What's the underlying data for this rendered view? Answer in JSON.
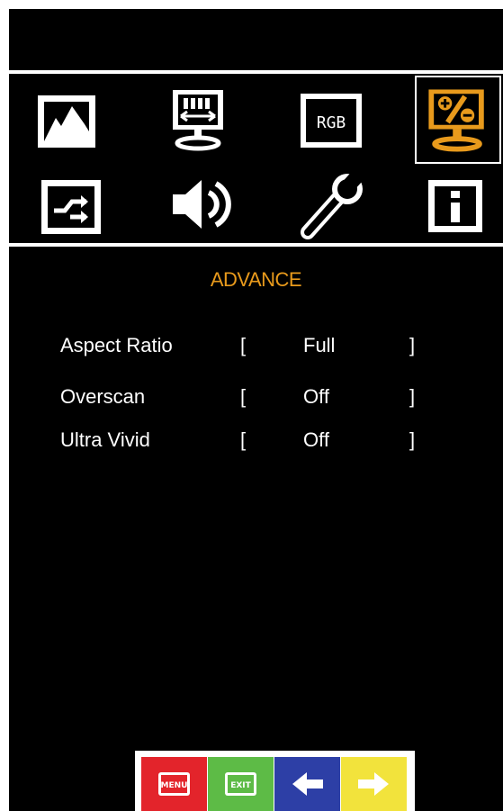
{
  "theme": {
    "background": "#000000",
    "foreground": "#ffffff",
    "accent": "#e89a1c",
    "menu_key_color": "#e3242b",
    "exit_key_color": "#5dbb46",
    "left_key_color": "#2d3fa6",
    "right_key_color": "#f2e33c"
  },
  "menu_icons": [
    {
      "name": "picture-icon",
      "text": ""
    },
    {
      "name": "display-icon",
      "text": ""
    },
    {
      "name": "rgb-icon",
      "text": "RGB"
    },
    {
      "name": "advance-icon",
      "text": "",
      "selected": true
    },
    {
      "name": "input-icon",
      "text": ""
    },
    {
      "name": "audio-icon",
      "text": ""
    },
    {
      "name": "setup-wrench-icon",
      "text": ""
    },
    {
      "name": "info-icon",
      "text": ""
    }
  ],
  "section": {
    "title": "ADVANCE"
  },
  "settings": [
    {
      "label": "Aspect Ratio",
      "open_bracket": "[",
      "value": "Full",
      "close_bracket": "]"
    },
    {
      "label": "Overscan",
      "open_bracket": "[",
      "value": "Off",
      "close_bracket": "]"
    },
    {
      "label": "Ultra Vivid",
      "open_bracket": "[",
      "value": "Off",
      "close_bracket": "]"
    }
  ],
  "keys": {
    "menu": {
      "icon": "menu-key-icon",
      "label": "MENU"
    },
    "exit": {
      "icon": "exit-key-icon",
      "label": "EXIT"
    },
    "left": {
      "icon": "arrow-left-icon"
    },
    "right": {
      "icon": "arrow-right-icon"
    }
  }
}
